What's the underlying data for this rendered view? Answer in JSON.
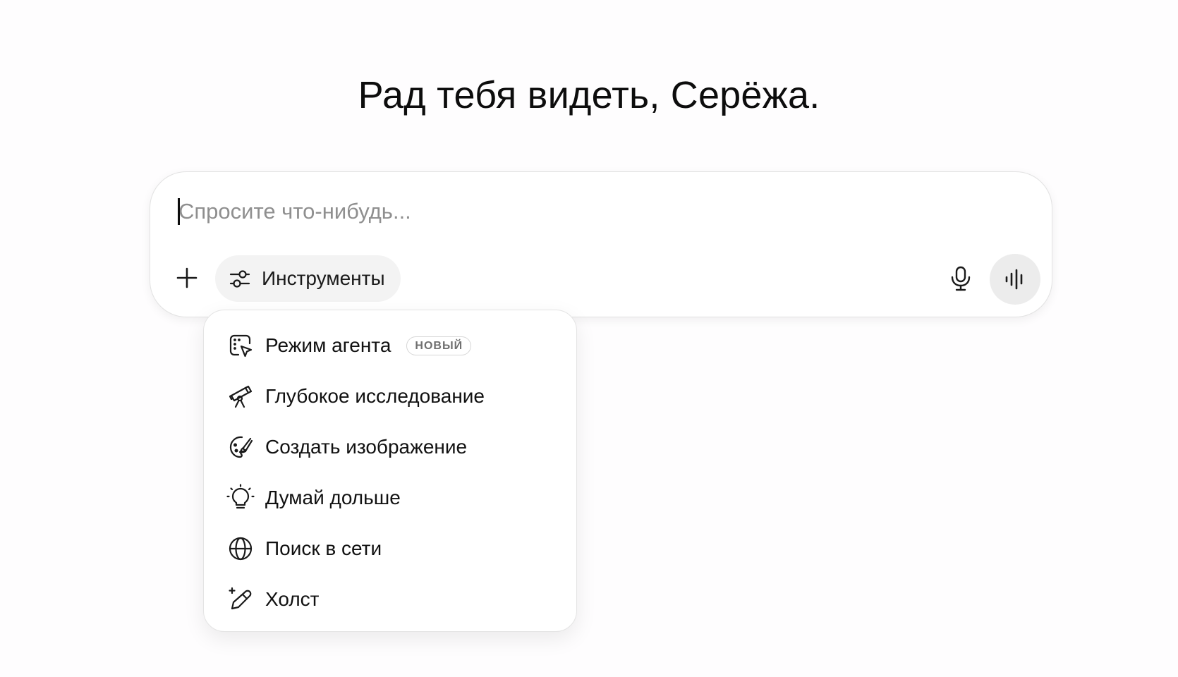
{
  "greeting": "Рад тебя видеть, Серёжа.",
  "composer": {
    "placeholder": "Спросите что-нибудь...",
    "value": "",
    "tools_label": "Инструменты",
    "add_icon": "plus-icon",
    "tools_icon": "sliders-icon",
    "mic_icon": "microphone-icon",
    "voice_icon": "voice-waveform-icon"
  },
  "tools_menu": {
    "items": [
      {
        "label": "Режим агента",
        "icon": "agent-cursor-icon",
        "badge": "НОВЫЙ"
      },
      {
        "label": "Глубокое исследование",
        "icon": "telescope-icon"
      },
      {
        "label": "Создать изображение",
        "icon": "palette-icon"
      },
      {
        "label": "Думай дольше",
        "icon": "lightbulb-icon"
      },
      {
        "label": "Поиск в сети",
        "icon": "globe-icon"
      },
      {
        "label": "Холст",
        "icon": "pencil-sparkle-icon"
      }
    ]
  },
  "colors": {
    "background": "#fefdfe",
    "text": "#0d0d0d",
    "placeholder": "#8f8f8f",
    "pill_background": "#f3f3f3",
    "voice_button_background": "#ececec",
    "border": "#e2e2e2"
  }
}
